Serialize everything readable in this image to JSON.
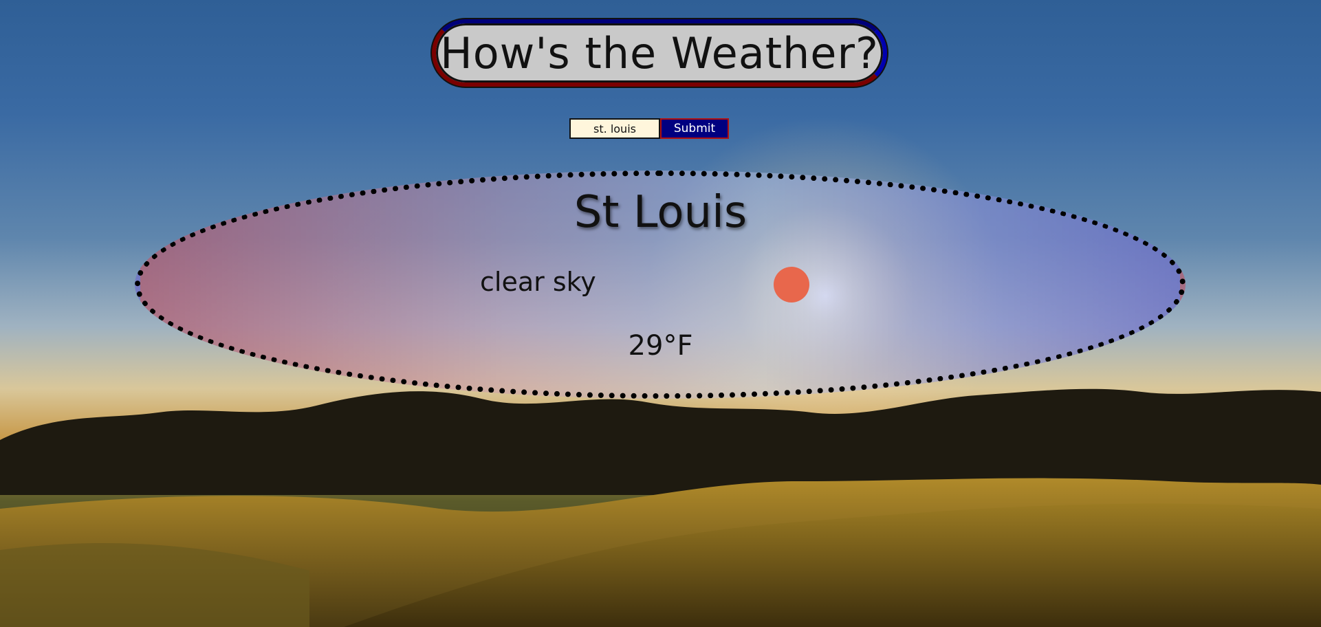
{
  "header": {
    "title": "How's the Weather?"
  },
  "search": {
    "value": "st. louis",
    "submit_label": "Submit"
  },
  "weather": {
    "city": "St Louis",
    "condition": "clear sky",
    "temperature": "29°F",
    "icon": "sun-icon"
  },
  "colors": {
    "title_background": "#c9c9c9",
    "submit_background": "#000080",
    "input_background": "#fff6dc",
    "sun_dot": "#e8674c"
  }
}
